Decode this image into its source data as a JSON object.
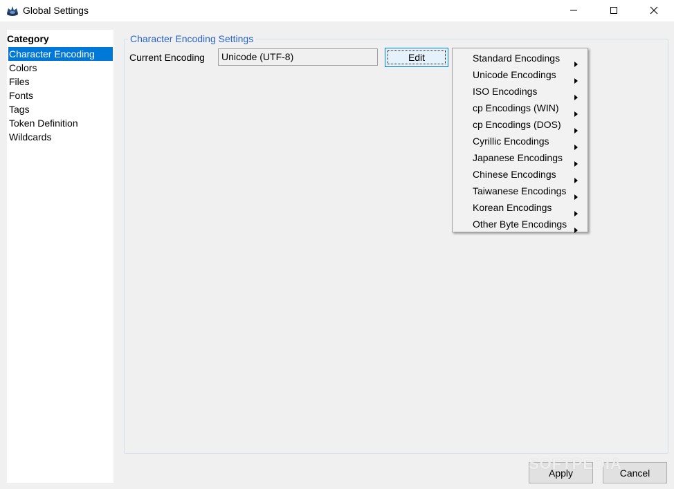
{
  "window": {
    "title": "Global Settings",
    "icons": {
      "app": "app-logo-icon",
      "minimize": "minimize-icon",
      "maximize": "maximize-icon",
      "close": "close-icon"
    }
  },
  "sidebar": {
    "header": "Category",
    "items": [
      {
        "label": "Character Encoding",
        "selected": true
      },
      {
        "label": "Colors"
      },
      {
        "label": "Files"
      },
      {
        "label": "Fonts"
      },
      {
        "label": "Tags"
      },
      {
        "label": "Token Definition"
      },
      {
        "label": "Wildcards"
      }
    ],
    "selected_color": "#0078d7"
  },
  "main": {
    "group_title": "Character Encoding Settings",
    "current_encoding_label": "Current Encoding",
    "current_encoding_value": "Unicode (UTF-8)",
    "edit_label": "Edit"
  },
  "menu": {
    "items": [
      {
        "label": "Standard Encodings"
      },
      {
        "label": "Unicode Encodings"
      },
      {
        "label": "ISO Encodings"
      },
      {
        "label": "cp Encodings (WIN)"
      },
      {
        "label": "cp Encodings (DOS)"
      },
      {
        "label": "Cyrillic Encodings"
      },
      {
        "label": "Japanese Encodings"
      },
      {
        "label": "Chinese Encodings"
      },
      {
        "label": "Taiwanese Encodings"
      },
      {
        "label": "Korean Encodings"
      },
      {
        "label": "Other Byte Encodings"
      }
    ],
    "submenu_icon": "submenu-arrow-icon"
  },
  "footer": {
    "apply_label": "Apply",
    "cancel_label": "Cancel",
    "watermark": "SOFTPEDIA"
  },
  "colors": {
    "accent": "#0078d7",
    "group_title": "#2a64c8"
  }
}
